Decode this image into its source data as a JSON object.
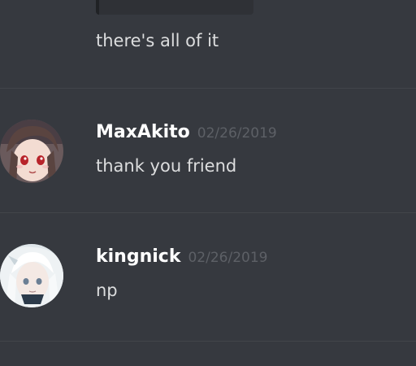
{
  "messages": [
    {
      "text": "there's all of it"
    },
    {
      "author": "MaxAkito",
      "timestamp": "02/26/2019",
      "text": "thank you friend",
      "avatar_icon": "anime-girl-avatar-icon"
    },
    {
      "author": "kingnick",
      "timestamp": "02/26/2019",
      "text": "np",
      "avatar_icon": "white-haired-anime-avatar-icon"
    }
  ],
  "colors": {
    "background": "#36393f",
    "divider": "#42454a",
    "username": "#ffffff",
    "message_text": "#dcddde",
    "timestamp": "#5d6066"
  }
}
